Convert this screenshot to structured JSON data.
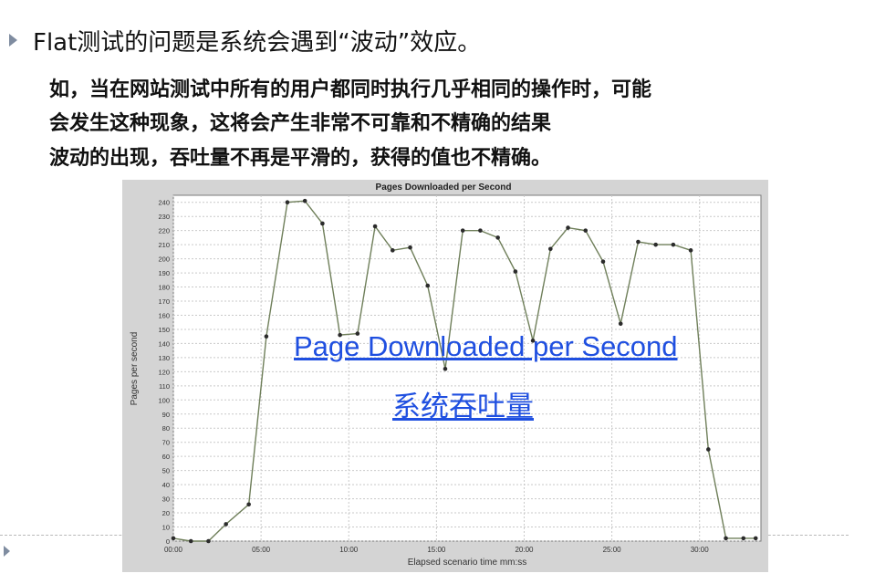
{
  "slide": {
    "heading": "Flat测试的问题是系统会遇到“波动”效应。",
    "lines": [
      "如，当在网站测试中所有的用户都同时执行几乎相同的操作时，可能",
      "会发生这种现象，这将会产生非常不可靠和不精确的结果",
      "波动的出现，吞吐量不再是平滑的，获得的值也不精确。"
    ],
    "links": [
      "Page Downloaded per Second",
      "系统吞吐量"
    ]
  },
  "colors": {
    "bullet": "#7f8ca0",
    "line": "#6f7f5a",
    "point": "#2b2b2b",
    "link": "#1f4fe0"
  },
  "chart_data": {
    "type": "line",
    "title": "Pages Downloaded per Second",
    "xlabel": "Elapsed scenario time mm:ss",
    "ylabel": "Pages per second",
    "xlim": [
      0,
      33.5
    ],
    "ylim": [
      0,
      245
    ],
    "x_ticks": [
      {
        "value": 0,
        "label": "00:00"
      },
      {
        "value": 5,
        "label": "05:00"
      },
      {
        "value": 10,
        "label": "10:00"
      },
      {
        "value": 15,
        "label": "15:00"
      },
      {
        "value": 20,
        "label": "20:00"
      },
      {
        "value": 25,
        "label": "25:00"
      },
      {
        "value": 30,
        "label": "30:00"
      }
    ],
    "y_ticks": [
      0,
      10,
      20,
      30,
      40,
      50,
      60,
      70,
      80,
      90,
      100,
      110,
      120,
      130,
      140,
      150,
      160,
      170,
      180,
      190,
      200,
      210,
      220,
      230,
      240
    ],
    "grid": true,
    "series": [
      {
        "x": [
          0,
          1,
          2,
          3,
          4.3,
          5.3,
          6.5,
          7.5,
          8.5,
          9.5,
          10.5,
          11.5,
          12.5,
          13.5,
          14.5,
          15.5,
          16.5,
          17.5,
          18.5,
          19.5,
          20.5,
          21.5,
          22.5,
          23.5,
          24.5,
          25.5,
          26.5,
          27.5,
          28.5,
          29.5,
          30.5,
          31.5,
          32.5,
          33.2
        ],
        "y": [
          2,
          0,
          0,
          12,
          26,
          145,
          240,
          241,
          225,
          146,
          147,
          223,
          206,
          208,
          181,
          122,
          220,
          220,
          215,
          191,
          142,
          207,
          222,
          220,
          198,
          154,
          212,
          210,
          210,
          206,
          65,
          2,
          2,
          2
        ]
      }
    ]
  }
}
